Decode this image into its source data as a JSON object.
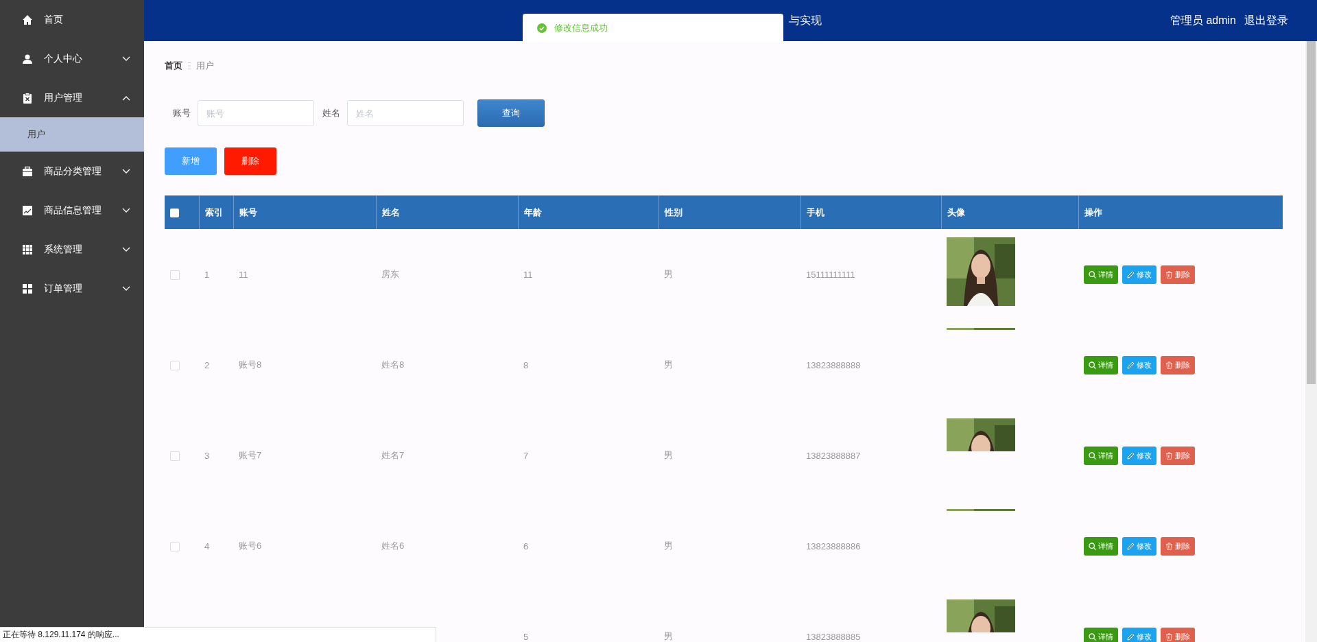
{
  "sidebar": {
    "items": [
      {
        "label": "首页",
        "kind": "link"
      },
      {
        "label": "个人中心",
        "kind": "menu",
        "expanded": false
      },
      {
        "label": "用户管理",
        "kind": "menu",
        "expanded": true,
        "children": [
          {
            "label": "用户",
            "selected": true
          }
        ]
      },
      {
        "label": "商品分类管理",
        "kind": "menu",
        "expanded": false
      },
      {
        "label": "商品信息管理",
        "kind": "menu",
        "expanded": false
      },
      {
        "label": "系统管理",
        "kind": "menu",
        "expanded": false
      },
      {
        "label": "订单管理",
        "kind": "menu",
        "expanded": false
      }
    ]
  },
  "top_bar": {
    "title": "与实现",
    "user": "管理员 admin",
    "logout": "退出登录"
  },
  "toast": {
    "kind": "success",
    "message": "修改信息成功"
  },
  "breadcrumb": [
    "首页",
    "用户"
  ],
  "search": {
    "fields": [
      {
        "label": "账号",
        "placeholder": "账号"
      },
      {
        "label": "姓名",
        "placeholder": "姓名"
      }
    ],
    "button": "查询"
  },
  "actions": [
    {
      "label": "新增",
      "kind": "add"
    },
    {
      "label": "删除",
      "kind": "delete"
    }
  ],
  "table": {
    "header_checked": false,
    "columns": [
      "索引",
      "账号",
      "姓名",
      "年龄",
      "性别",
      "手机",
      "头像",
      "操作"
    ],
    "rows": [
      {
        "checked": false,
        "cells": [
          "1",
          "11",
          "房东",
          "11",
          "男",
          "15111111111"
        ],
        "avatar": {
          "kind": "full"
        },
        "actions": [
          {
            "label": "详情",
            "kind": "detail"
          },
          {
            "label": "修改",
            "kind": "edit"
          },
          {
            "label": "删除",
            "kind": "delete"
          }
        ]
      },
      {
        "checked": false,
        "cells": [
          "2",
          "账号8",
          "姓名8",
          "8",
          "男",
          "13823888888"
        ],
        "avatar": {
          "kind": "strip"
        },
        "actions": [
          {
            "label": "详情",
            "kind": "detail"
          },
          {
            "label": "修改",
            "kind": "edit"
          },
          {
            "label": "删除",
            "kind": "delete"
          }
        ]
      },
      {
        "checked": false,
        "cells": [
          "3",
          "账号7",
          "姓名7",
          "7",
          "男",
          "13823888887"
        ],
        "avatar": {
          "kind": "partial"
        },
        "actions": [
          {
            "label": "详情",
            "kind": "detail"
          },
          {
            "label": "修改",
            "kind": "edit"
          },
          {
            "label": "删除",
            "kind": "delete"
          }
        ]
      },
      {
        "checked": false,
        "cells": [
          "4",
          "账号6",
          "姓名6",
          "6",
          "男",
          "13823888886"
        ],
        "avatar": {
          "kind": "strip"
        },
        "actions": [
          {
            "label": "详情",
            "kind": "detail"
          },
          {
            "label": "修改",
            "kind": "edit"
          },
          {
            "label": "删除",
            "kind": "delete"
          }
        ]
      },
      {
        "cells": [
          null,
          null,
          null,
          "5",
          "男",
          "13823888885"
        ],
        "avatar": {
          "kind": "partial"
        },
        "actions": [
          {
            "label": "详情",
            "kind": "detail"
          },
          {
            "label": "修改",
            "kind": "edit"
          },
          {
            "label": "删除",
            "kind": "delete"
          }
        ]
      }
    ]
  },
  "status_bar": {
    "text": "正在等待 8.129.11.174 的响应..."
  }
}
